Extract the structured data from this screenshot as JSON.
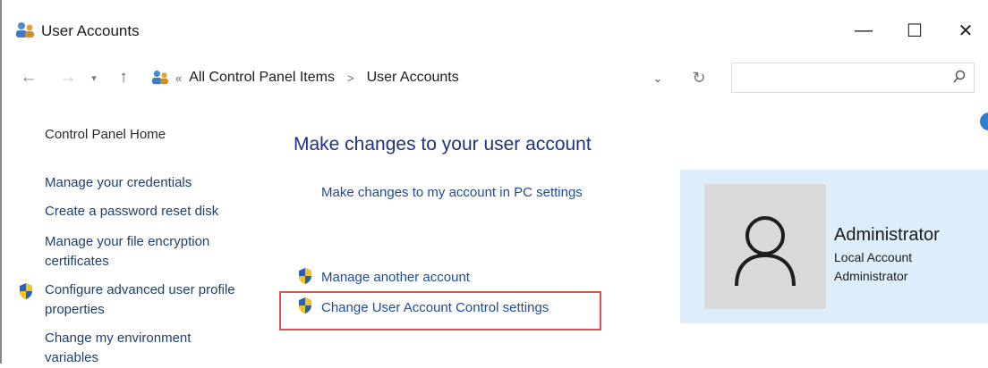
{
  "window": {
    "title": "User Accounts",
    "minimize_glyph": "—",
    "maximize_glyph": "☐",
    "close_glyph": "✕"
  },
  "nav": {
    "back_glyph": "←",
    "forward_glyph": "→",
    "recent_glyph": "▾",
    "up_glyph": "↑",
    "breadcrumb_sep": "«",
    "breadcrumb": [
      "All Control Panel Items",
      "User Accounts"
    ],
    "breadcrumb_arrow": ">",
    "dropdown_glyph": "⌄",
    "refresh_glyph": "↻",
    "search_placeholder": ""
  },
  "sidebar": {
    "home": "Control Panel Home",
    "items": [
      "Manage your credentials",
      "Create a password reset disk",
      "Manage your file encryption certificates",
      "Configure advanced user profile properties",
      "Change my environment variables"
    ]
  },
  "main": {
    "heading": "Make changes to your user account",
    "pc_settings_link": "Make changes to my account in PC settings",
    "manage_another": "Manage another account",
    "uac_settings": "Change User Account Control settings"
  },
  "account": {
    "name": "Administrator",
    "type": "Local Account",
    "role": "Administrator"
  },
  "colors": {
    "link": "#1f4a9a",
    "heading": "#1e3287",
    "highlight": "#d9534f",
    "card_bg": "#ddeefa"
  },
  "icons": [
    "users-icon",
    "search-icon",
    "shield-icon",
    "user-avatar-icon",
    "help-icon"
  ]
}
